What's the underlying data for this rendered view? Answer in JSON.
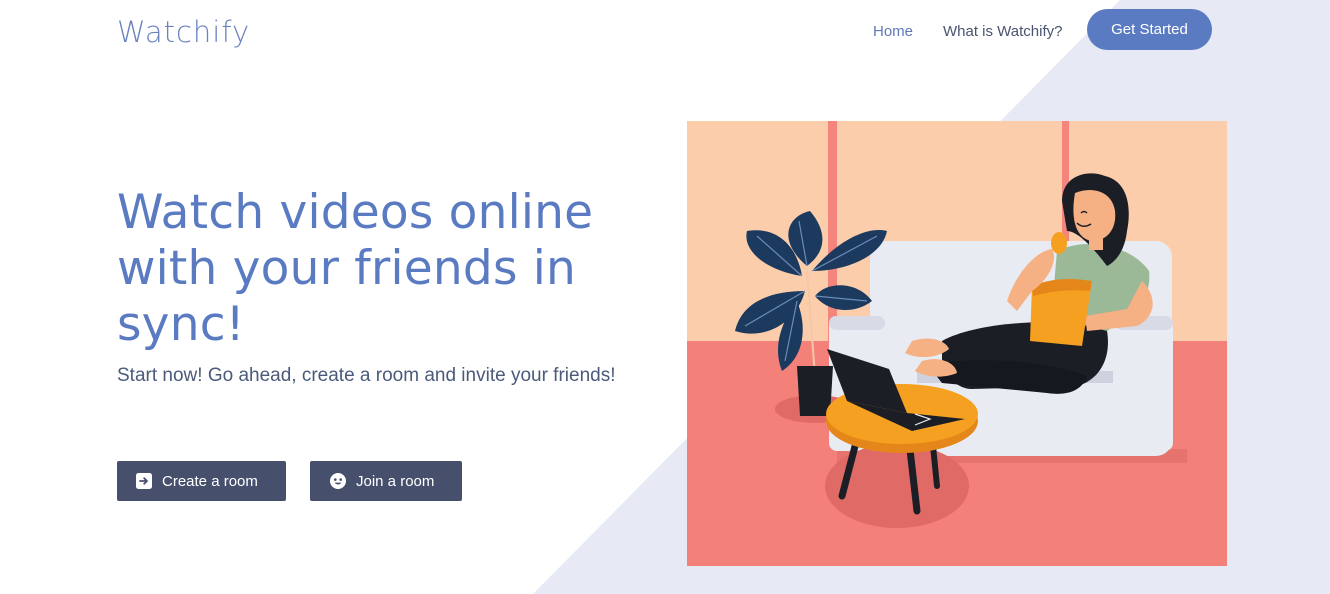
{
  "brand": {
    "logo_text": "Watchify"
  },
  "nav": {
    "home_label": "Home",
    "what_label": "What is Watchify?",
    "cta_label": "Get Started"
  },
  "hero": {
    "title": "Watch videos online with your friends in sync!",
    "subtitle": "Start now! Go ahead, create a room and invite your friends!",
    "create_button": {
      "label": "Create a room",
      "icon": "enter-icon"
    },
    "join_button": {
      "label": "Join a room",
      "icon": "smiley-icon"
    }
  },
  "illustration": {
    "name": "woman-watching-laptop-illustration"
  },
  "colors": {
    "accent": "#5a7bc1",
    "button_dark": "#46506d",
    "background_shape": "#e7eaf4",
    "illustration_wall": "#fbcdaa",
    "illustration_floor": "#f3817a"
  }
}
